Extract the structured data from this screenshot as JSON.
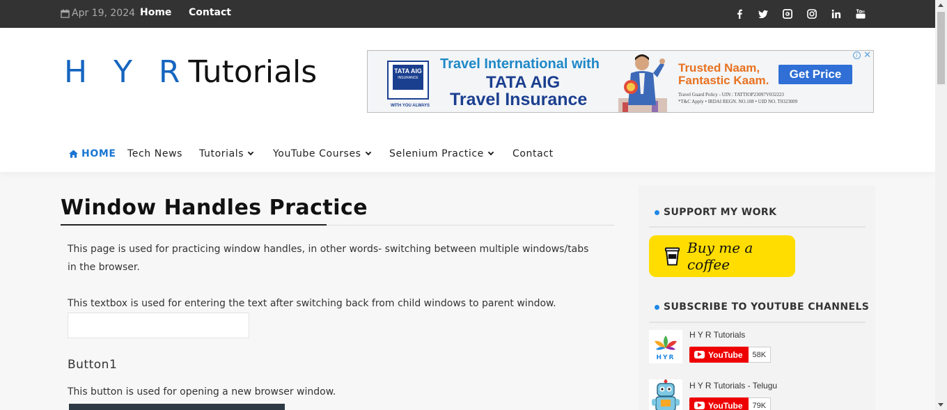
{
  "topbar": {
    "date": "Apr 19, 2024",
    "links": [
      "Home",
      "Contact"
    ],
    "social_icons": [
      "facebook-icon",
      "twitter-icon",
      "google-plus-icon",
      "instagram-icon",
      "linkedin-icon",
      "youtube-icon"
    ]
  },
  "header": {
    "logo_blue": "H Y R",
    "logo_black": "Tutorials",
    "ad": {
      "brand": "TATA AIG",
      "brand_sub": "INSURANCE",
      "brand_tag": "WITH YOU ALWAYS",
      "headline1": "Travel International with",
      "headline2": "TATA AIG",
      "headline3": "Travel Insurance",
      "tagline": "Trusted Naam, Fantastic Kaam.",
      "cta": "Get Price",
      "fine1": "Travel Guard Policy - UIN : TATTIOP23097V032223",
      "fine2": "*T&C Apply  •  IRDAI REGN. NO.108  •  UID NO. T0323009"
    }
  },
  "nav": {
    "items": [
      "HOME",
      "Tech News",
      "Tutorials",
      "YouTube Courses",
      "Selenium Practice",
      "Contact"
    ]
  },
  "main": {
    "title": "Window Handles Practice",
    "intro": "This page is used for practicing window handles, in other words- switching between multiple windows/tabs in the browser.",
    "textbox_label": "This textbox is used for entering the text after switching back from child windows to parent window.",
    "textbox_value": "",
    "button1_heading": "Button1",
    "button1_desc": "This button is used for opening a new browser window."
  },
  "sidebar": {
    "support_title": "SUPPORT MY WORK",
    "coffee_label": "Buy me a coffee",
    "subscribe_title": "SUBSCRIBE TO YOUTUBE CHANNELS",
    "channels": [
      {
        "name": "H Y R Tutorials",
        "button": "YouTube",
        "count": "58K"
      },
      {
        "name": "H Y R Tutorials - Telugu",
        "button": "YouTube",
        "count": "79K"
      }
    ]
  },
  "colors": {
    "topbar_bg": "#333333",
    "accent": "#1976d2",
    "coffee_bg": "#ffdd00",
    "youtube_red": "#ee0000"
  }
}
